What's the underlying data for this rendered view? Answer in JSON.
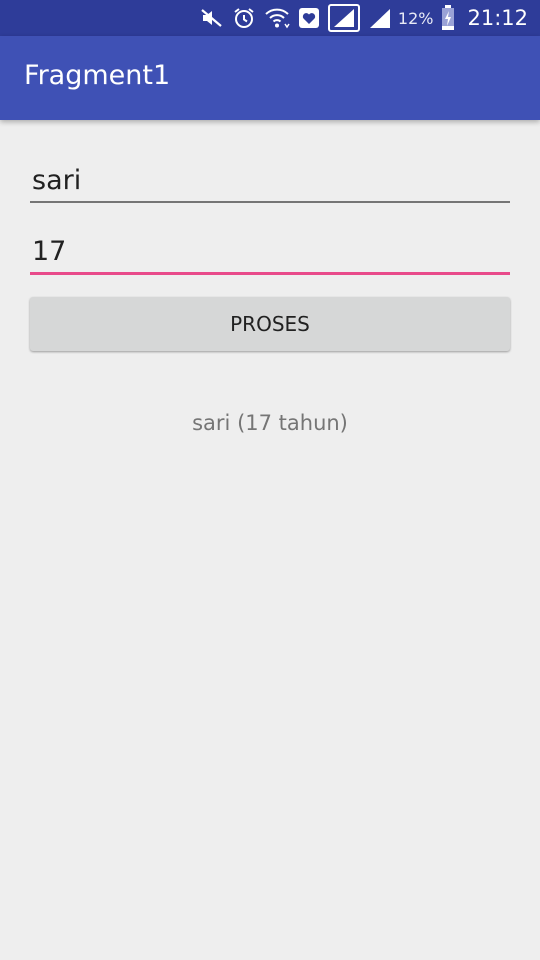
{
  "status_bar": {
    "icons": [
      "mute-icon",
      "alarm-icon",
      "wifi-icon",
      "health-icon",
      "signal-sim1-icon",
      "signal-sim2-icon",
      "battery-charging-icon"
    ],
    "battery_percent": "12%",
    "time": "21:12"
  },
  "app_bar": {
    "title": "Fragment1"
  },
  "form": {
    "name_value": "sari",
    "age_value": "17",
    "submit_label": "PROSES"
  },
  "result": {
    "text": "sari (17 tahun)"
  },
  "colors": {
    "status_bar": "#2e3c99",
    "app_bar": "#3f51b5",
    "accent": "#e84a8a",
    "background": "#eeeeee",
    "button": "#d6d7d7"
  }
}
